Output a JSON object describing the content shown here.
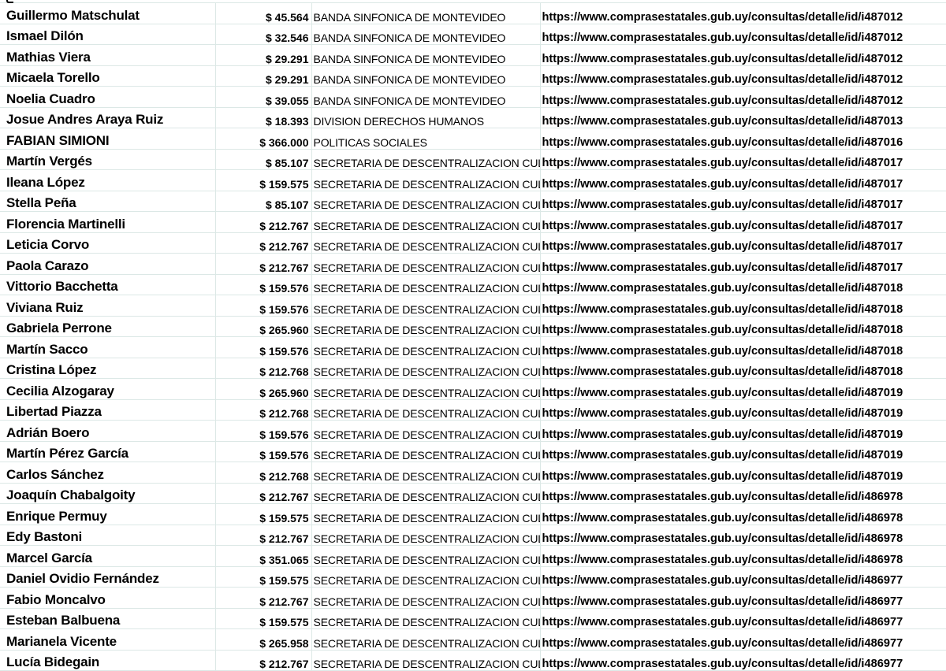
{
  "sheet": {
    "rows": [
      {
        "name": "Guillermo Matschulat",
        "amount": "$ 45.564",
        "dept": "BANDA SINFONICA DE MONTEVIDEO",
        "url": "https://www.comprasestatales.gub.uy/consultas/detalle/id/i487012"
      },
      {
        "name": "Ismael Dilón",
        "amount": "$ 32.546",
        "dept": "BANDA SINFONICA DE MONTEVIDEO",
        "url": "https://www.comprasestatales.gub.uy/consultas/detalle/id/i487012"
      },
      {
        "name": "Mathias Viera",
        "amount": "$ 29.291",
        "dept": "BANDA SINFONICA DE MONTEVIDEO",
        "url": "https://www.comprasestatales.gub.uy/consultas/detalle/id/i487012"
      },
      {
        "name": "Micaela Torello",
        "amount": "$ 29.291",
        "dept": "BANDA SINFONICA DE MONTEVIDEO",
        "url": "https://www.comprasestatales.gub.uy/consultas/detalle/id/i487012"
      },
      {
        "name": "Noelia Cuadro",
        "amount": "$ 39.055",
        "dept": "BANDA SINFONICA DE MONTEVIDEO",
        "url": "https://www.comprasestatales.gub.uy/consultas/detalle/id/i487012"
      },
      {
        "name": "Josue Andres Araya Ruiz",
        "amount": "$ 18.393",
        "dept": "DIVISION DERECHOS HUMANOS",
        "url": "https://www.comprasestatales.gub.uy/consultas/detalle/id/i487013"
      },
      {
        "name": "FABIAN SIMIONI",
        "amount": "$ 366.000",
        "dept": "POLITICAS SOCIALES",
        "url": "https://www.comprasestatales.gub.uy/consultas/detalle/id/i487016"
      },
      {
        "name": "Martín Vergés",
        "amount": "$ 85.107",
        "dept": "SECRETARIA DE DESCENTRALIZACION CULT",
        "url": "https://www.comprasestatales.gub.uy/consultas/detalle/id/i487017"
      },
      {
        "name": "Ileana López",
        "amount": "$ 159.575",
        "dept": "SECRETARIA DE DESCENTRALIZACION CULT",
        "url": "https://www.comprasestatales.gub.uy/consultas/detalle/id/i487017"
      },
      {
        "name": "Stella Peña",
        "amount": "$ 85.107",
        "dept": "SECRETARIA DE DESCENTRALIZACION CULT",
        "url": "https://www.comprasestatales.gub.uy/consultas/detalle/id/i487017"
      },
      {
        "name": "Florencia Martinelli",
        "amount": "$ 212.767",
        "dept": "SECRETARIA DE DESCENTRALIZACION CULT",
        "url": "https://www.comprasestatales.gub.uy/consultas/detalle/id/i487017"
      },
      {
        "name": "Leticia Corvo",
        "amount": "$ 212.767",
        "dept": "SECRETARIA DE DESCENTRALIZACION CULT",
        "url": "https://www.comprasestatales.gub.uy/consultas/detalle/id/i487017"
      },
      {
        "name": "Paola Carazo",
        "amount": "$ 212.767",
        "dept": "SECRETARIA DE DESCENTRALIZACION CULT",
        "url": "https://www.comprasestatales.gub.uy/consultas/detalle/id/i487017"
      },
      {
        "name": "Vittorio Bacchetta",
        "amount": "$ 159.576",
        "dept": "SECRETARIA DE DESCENTRALIZACION CULT",
        "url": "https://www.comprasestatales.gub.uy/consultas/detalle/id/i487018"
      },
      {
        "name": "Viviana Ruiz",
        "amount": "$ 159.576",
        "dept": "SECRETARIA DE DESCENTRALIZACION CULT",
        "url": "https://www.comprasestatales.gub.uy/consultas/detalle/id/i487018"
      },
      {
        "name": "Gabriela Perrone",
        "amount": "$ 265.960",
        "dept": "SECRETARIA DE DESCENTRALIZACION CULT",
        "url": "https://www.comprasestatales.gub.uy/consultas/detalle/id/i487018"
      },
      {
        "name": "Martín Sacco",
        "amount": "$ 159.576",
        "dept": "SECRETARIA DE DESCENTRALIZACION CULT",
        "url": "https://www.comprasestatales.gub.uy/consultas/detalle/id/i487018"
      },
      {
        "name": "Cristina López",
        "amount": "$ 212.768",
        "dept": "SECRETARIA DE DESCENTRALIZACION CULT",
        "url": "https://www.comprasestatales.gub.uy/consultas/detalle/id/i487018"
      },
      {
        "name": "Cecilia Alzogaray",
        "amount": "$ 265.960",
        "dept": "SECRETARIA DE DESCENTRALIZACION CULT",
        "url": "https://www.comprasestatales.gub.uy/consultas/detalle/id/i487019"
      },
      {
        "name": "Libertad Piazza",
        "amount": "$ 212.768",
        "dept": "SECRETARIA DE DESCENTRALIZACION CULT",
        "url": "https://www.comprasestatales.gub.uy/consultas/detalle/id/i487019"
      },
      {
        "name": "Adrián Boero",
        "amount": "$ 159.576",
        "dept": "SECRETARIA DE DESCENTRALIZACION CULT",
        "url": "https://www.comprasestatales.gub.uy/consultas/detalle/id/i487019"
      },
      {
        "name": "Martín Pérez García",
        "amount": "$ 159.576",
        "dept": "SECRETARIA DE DESCENTRALIZACION CULT",
        "url": "https://www.comprasestatales.gub.uy/consultas/detalle/id/i487019"
      },
      {
        "name": "Carlos Sánchez",
        "amount": "$ 212.768",
        "dept": "SECRETARIA DE DESCENTRALIZACION CULT",
        "url": "https://www.comprasestatales.gub.uy/consultas/detalle/id/i487019"
      },
      {
        "name": "Joaquín Chabalgoity",
        "amount": "$ 212.767",
        "dept": "SECRETARIA DE DESCENTRALIZACION CULT",
        "url": "https://www.comprasestatales.gub.uy/consultas/detalle/id/i486978"
      },
      {
        "name": "Enrique Permuy",
        "amount": "$ 159.575",
        "dept": "SECRETARIA DE DESCENTRALIZACION CULT",
        "url": "https://www.comprasestatales.gub.uy/consultas/detalle/id/i486978"
      },
      {
        "name": "Edy Bastoni",
        "amount": "$ 212.767",
        "dept": "SECRETARIA DE DESCENTRALIZACION CULT",
        "url": "https://www.comprasestatales.gub.uy/consultas/detalle/id/i486978"
      },
      {
        "name": "Marcel García",
        "amount": "$ 351.065",
        "dept": "SECRETARIA DE DESCENTRALIZACION CULT",
        "url": "https://www.comprasestatales.gub.uy/consultas/detalle/id/i486978"
      },
      {
        "name": "Daniel Ovidio Fernández",
        "amount": "$ 159.575",
        "dept": "SECRETARIA DE DESCENTRALIZACION CULT",
        "url": "https://www.comprasestatales.gub.uy/consultas/detalle/id/i486977"
      },
      {
        "name": "Fabio Moncalvo",
        "amount": "$ 212.767",
        "dept": "SECRETARIA DE DESCENTRALIZACION CULT",
        "url": "https://www.comprasestatales.gub.uy/consultas/detalle/id/i486977"
      },
      {
        "name": "Esteban Balbuena",
        "amount": "$ 159.575",
        "dept": "SECRETARIA DE DESCENTRALIZACION CULT",
        "url": "https://www.comprasestatales.gub.uy/consultas/detalle/id/i486977"
      },
      {
        "name": "Marianela Vicente",
        "amount": "$ 265.958",
        "dept": "SECRETARIA DE DESCENTRALIZACION CULT",
        "url": "https://www.comprasestatales.gub.uy/consultas/detalle/id/i486977"
      },
      {
        "name": "Lucía Bidegain",
        "amount": "$ 212.767",
        "dept": "SECRETARIA DE DESCENTRALIZACION CULT",
        "url": "https://www.comprasestatales.gub.uy/consultas/detalle/id/i486977"
      }
    ]
  },
  "colors": {
    "gridline": "#dce8e6",
    "text": "#000000",
    "background": "#ffffff"
  }
}
